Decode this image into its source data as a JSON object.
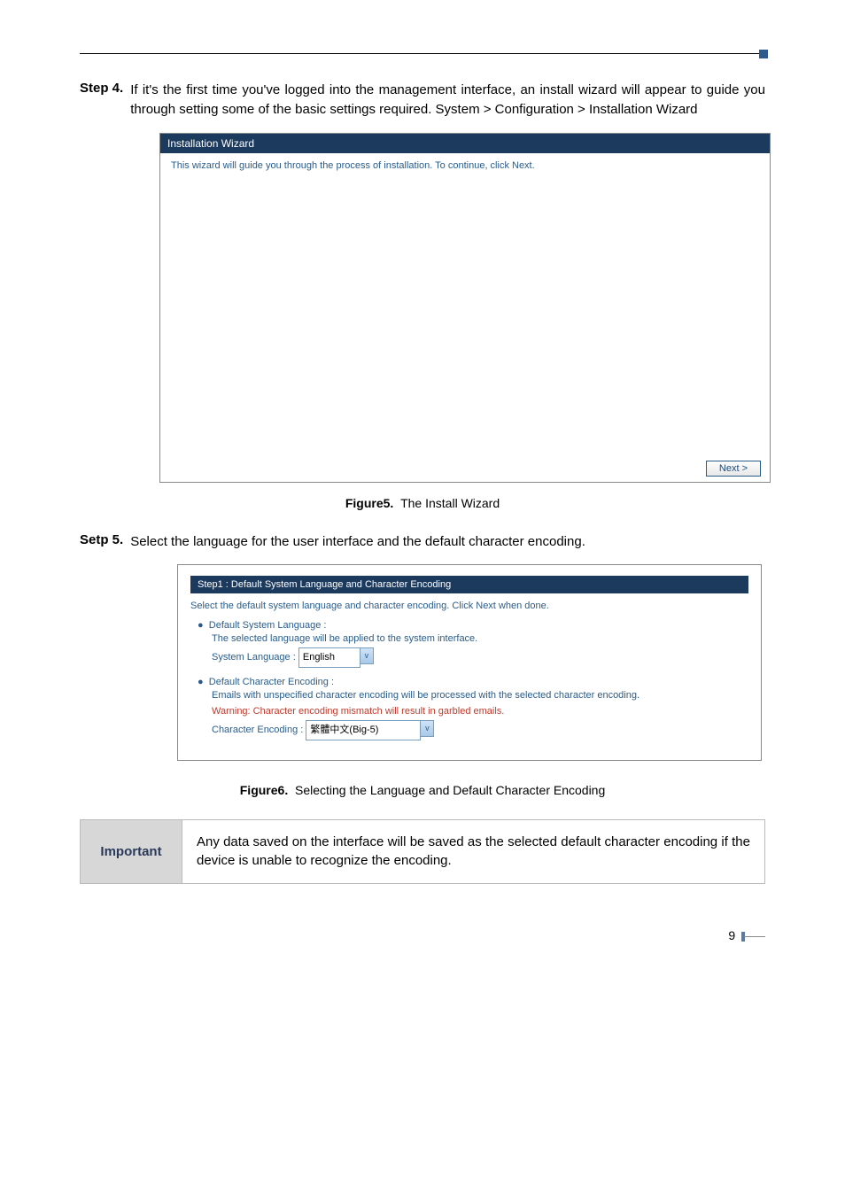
{
  "step4": {
    "label": "Step 4.",
    "text": "If it's the first time you've logged into the management interface, an install wizard will appear to guide you through setting some of the basic settings required. System > Configuration > Installation Wizard"
  },
  "wizard": {
    "title": "Installation Wizard",
    "instruction": "This wizard will guide you through the process of installation. To continue, click Next.",
    "next_button": "Next >"
  },
  "figure5": {
    "label": "Figure5.",
    "caption": "The Install Wizard"
  },
  "step5": {
    "label": "Setp 5.",
    "text": "Select the language for the user interface and the default character encoding."
  },
  "step1panel": {
    "title": "Step1 : Default System Language and Character Encoding",
    "instruction": "Select the default system language and character encoding. Click Next  when done.",
    "lang_header": "Default System Language :",
    "lang_desc": "The selected language will be applied to the system interface.",
    "lang_label": "System Language :",
    "lang_value": "English",
    "enc_header": "Default Character Encoding :",
    "enc_desc": "Emails with unspecified character encoding will be processed with the selected character encoding.",
    "enc_warning": "Warning: Character encoding mismatch will result in garbled emails.",
    "enc_label": "Character Encoding :",
    "enc_value": "繁體中文(Big-5)"
  },
  "figure6": {
    "label": "Figure6.",
    "caption": "Selecting the Language and Default Character Encoding"
  },
  "important": {
    "label": "Important",
    "text": "Any data saved on the interface will be saved as the selected default character encoding if the device is unable to recognize the encoding."
  },
  "page_number": "9"
}
